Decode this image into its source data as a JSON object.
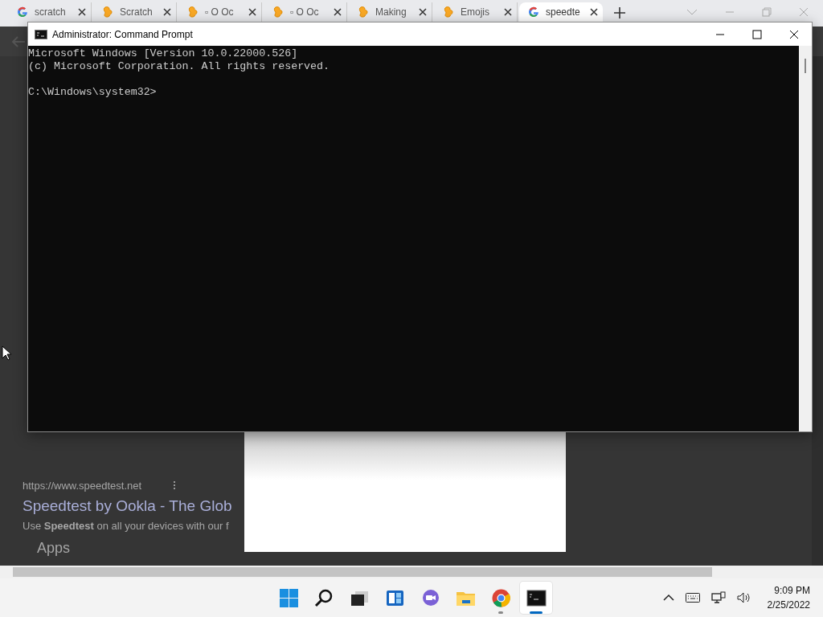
{
  "browser": {
    "tabs": [
      {
        "label": "scratch",
        "kind": "google",
        "selected": false
      },
      {
        "label": "Scratch",
        "kind": "scratch",
        "selected": false
      },
      {
        "label": "▫ O Oc",
        "kind": "scratch",
        "selected": false
      },
      {
        "label": "▫ O Oc",
        "kind": "scratch",
        "selected": false
      },
      {
        "label": "Making",
        "kind": "scratch",
        "selected": false
      },
      {
        "label": "Emojis",
        "kind": "scratch",
        "selected": false
      },
      {
        "label": "speedte",
        "kind": "google",
        "selected": true
      }
    ],
    "content": {
      "url": "https://www.speedtest.net",
      "result_title": "Speedtest by Ookla - The Glob",
      "snippet": "Use **Speedtest** on all your devices with our f",
      "section": "Apps"
    }
  },
  "console_window": {
    "title": "Administrator: Command Prompt",
    "header_lines": [
      "Microsoft Windows [Version 10.0.22000.526]",
      "(c) Microsoft Corporation. All rights reserved."
    ],
    "prompt": "C:\\Windows\\system32>"
  },
  "taskbar": {
    "apps": [
      {
        "kind": "start",
        "running": false,
        "focused": false
      },
      {
        "kind": "search",
        "running": false,
        "focused": false
      },
      {
        "kind": "taskview",
        "running": false,
        "focused": false
      },
      {
        "kind": "widgets",
        "running": false,
        "focused": false
      },
      {
        "kind": "chat",
        "running": false,
        "focused": false
      },
      {
        "kind": "explorer",
        "running": false,
        "focused": false
      },
      {
        "kind": "chrome",
        "running": true,
        "focused": false
      },
      {
        "kind": "terminal",
        "running": true,
        "focused": true
      }
    ],
    "time": "9:09 PM",
    "date": "2/25/2022"
  }
}
